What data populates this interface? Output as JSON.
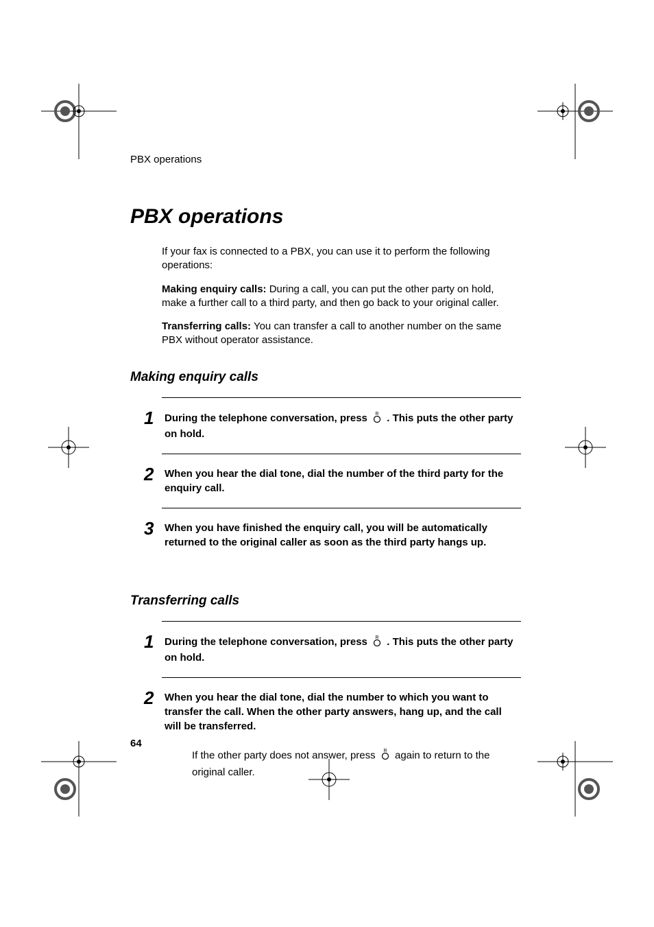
{
  "running_header": "PBX operations",
  "title": "PBX operations",
  "intro": "If your fax is connected to a PBX, you can use it to perform the following operations:",
  "enquiry_label": "Making enquiry calls:",
  "enquiry_desc": " During a call, you can put the other party on hold, make a further call to a third party, and then go back to your original caller.",
  "transfer_label": "Transferring calls:",
  "transfer_desc": " You can transfer a call to another number on the same PBX without operator assistance.",
  "section1": {
    "heading": "Making enquiry calls",
    "steps": [
      {
        "num": "1",
        "text_before": "During the telephone conversation, press ",
        "text_after": " . This puts the other party on hold.",
        "icon": "r-button"
      },
      {
        "num": "2",
        "text_before": "When you hear the dial tone, dial the number of the third party for the enquiry call.",
        "text_after": "",
        "icon": null
      },
      {
        "num": "3",
        "text_before": "When you have finished the enquiry call, you will be automatically returned to the original caller as soon as the third party hangs up.",
        "text_after": "",
        "icon": null
      }
    ]
  },
  "section2": {
    "heading": "Transferring calls",
    "steps": [
      {
        "num": "1",
        "text_before": "During the telephone conversation, press ",
        "text_after": " . This puts the other party on hold.",
        "icon": "r-button"
      },
      {
        "num": "2",
        "text_before": "When you hear the dial tone, dial the number to which you want to transfer the call. When the other party answers, hang up, and the call will be transferred.",
        "text_after": "",
        "icon": null,
        "note_before": "If the other party does not answer, press ",
        "note_after": " again to return to the original caller.",
        "note_icon": "r-button"
      }
    ]
  },
  "page_number": "64"
}
